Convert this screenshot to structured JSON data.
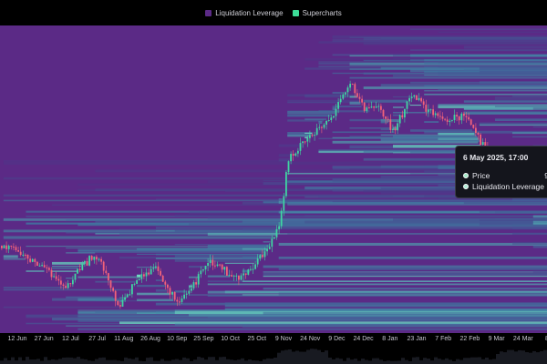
{
  "legend": [
    {
      "label": "Liquidation Leverage",
      "color": "#5b2a86"
    },
    {
      "label": "Supercharts",
      "color": "#3ddc97"
    }
  ],
  "tooltip": {
    "date": "6 May 2025, 17:00",
    "rows": [
      {
        "label": "Price",
        "value": "9",
        "color": "#a4e8c8"
      },
      {
        "label": "Liquidation Leverage",
        "value": "",
        "color": "#b1ecd6"
      }
    ]
  },
  "colors": {
    "background": "#5b2a86",
    "heat_low": "#4a2f86",
    "heat_mid": "#3f7fa3",
    "heat_high": "#7cf0c8",
    "candle_up": "#3fd6a2",
    "candle_down": "#f2627a"
  },
  "chart_data": {
    "type": "heatmap",
    "overlay": "candlestick",
    "x_ticks": [
      "12 Jun",
      "27 Jun",
      "12 Jul",
      "27 Jul",
      "11 Aug",
      "26 Aug",
      "10 Sep",
      "25 Sep",
      "10 Oct",
      "25 Oct",
      "9 Nov",
      "24 Nov",
      "9 Dec",
      "24 Dec",
      "8 Jan",
      "23 Jan",
      "7 Feb",
      "22 Feb",
      "9 Mar",
      "24 Mar",
      "8 A"
    ],
    "price_series": [
      {
        "date": "2024-05-30",
        "close": 0.71
      },
      {
        "date": "2024-06-12",
        "close": 0.66
      },
      {
        "date": "2024-06-27",
        "close": 0.57
      },
      {
        "date": "2024-07-05",
        "close": 0.52
      },
      {
        "date": "2024-07-12",
        "close": 0.6
      },
      {
        "date": "2024-07-22",
        "close": 0.67
      },
      {
        "date": "2024-08-05",
        "close": 0.42
      },
      {
        "date": "2024-08-15",
        "close": 0.56
      },
      {
        "date": "2024-08-26",
        "close": 0.6
      },
      {
        "date": "2024-09-06",
        "close": 0.45
      },
      {
        "date": "2024-09-14",
        "close": 0.5
      },
      {
        "date": "2024-09-25",
        "close": 0.63
      },
      {
        "date": "2024-10-05",
        "close": 0.59
      },
      {
        "date": "2024-10-15",
        "close": 0.56
      },
      {
        "date": "2024-10-27",
        "close": 0.67
      },
      {
        "date": "2024-11-05",
        "close": 0.79
      },
      {
        "date": "2024-11-10",
        "close": 1.12
      },
      {
        "date": "2024-11-20",
        "close": 1.2
      },
      {
        "date": "2024-11-28",
        "close": 1.27
      },
      {
        "date": "2024-12-06",
        "close": 1.32
      },
      {
        "date": "2024-12-16",
        "close": 1.48
      },
      {
        "date": "2024-12-24",
        "close": 1.36
      },
      {
        "date": "2025-01-03",
        "close": 1.35
      },
      {
        "date": "2025-01-10",
        "close": 1.24
      },
      {
        "date": "2025-01-20",
        "close": 1.42
      },
      {
        "date": "2025-01-28",
        "close": 1.36
      },
      {
        "date": "2025-02-05",
        "close": 1.3
      },
      {
        "date": "2025-02-20",
        "close": 1.32
      },
      {
        "date": "2025-03-01",
        "close": 1.2
      },
      {
        "date": "2025-03-10",
        "close": 1.08
      },
      {
        "date": "2025-03-20",
        "close": 1.12
      },
      {
        "date": "2025-04-01",
        "close": 0.98
      },
      {
        "date": "2025-04-08",
        "close": 0.96
      }
    ],
    "legend_position": "top-center",
    "grid": false
  }
}
